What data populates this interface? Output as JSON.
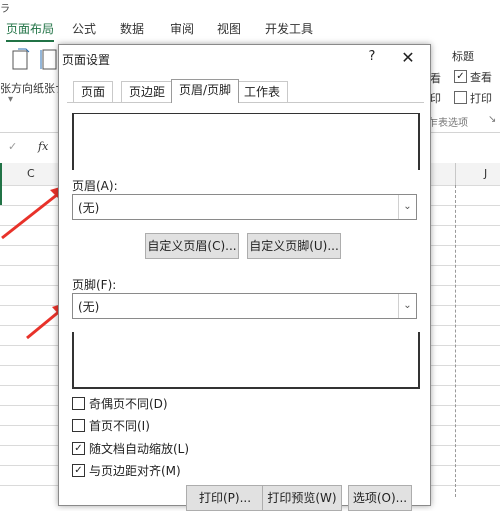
{
  "top_sliver": "ラ",
  "ribbon_tabs": [
    "页面布局",
    "公式",
    "数据",
    "审阅",
    "视图",
    "开发工具"
  ],
  "ribbon": {
    "orientation_label": "张方向",
    "size_label": "纸张ナ",
    "group_label_right": "标题",
    "view_check": "查看",
    "print_check": "打印",
    "right_char1": "看",
    "right_char2": "印",
    "sheet_options": "乍表选项",
    "fx": "fx",
    "check": "✓"
  },
  "column_headers": [
    "C",
    "J"
  ],
  "dialog": {
    "title": "页面设置",
    "help": "?",
    "close": "✕",
    "tabs": [
      "页面",
      "页边距",
      "页眉/页脚",
      "工作表"
    ],
    "header_label": "页眉(A):",
    "header_value": "(无)",
    "custom_header_button": "自定义页眉(C)...",
    "custom_footer_button": "自定义页脚(U)...",
    "footer_label": "页脚(F):",
    "footer_value": "(无)",
    "options": [
      {
        "label": "奇偶页不同(D)",
        "checked": false
      },
      {
        "label": "首页不同(I)",
        "checked": false
      },
      {
        "label": "随文档自动缩放(L)",
        "checked": true
      },
      {
        "label": "与页边距对齐(M)",
        "checked": true
      }
    ],
    "print_button": "打印(P)...",
    "print_preview_button": "打印预览(W)",
    "options_button": "选项(O)..."
  },
  "colors": {
    "excel_green": "#217346",
    "arrow_red": "#e8322a"
  }
}
